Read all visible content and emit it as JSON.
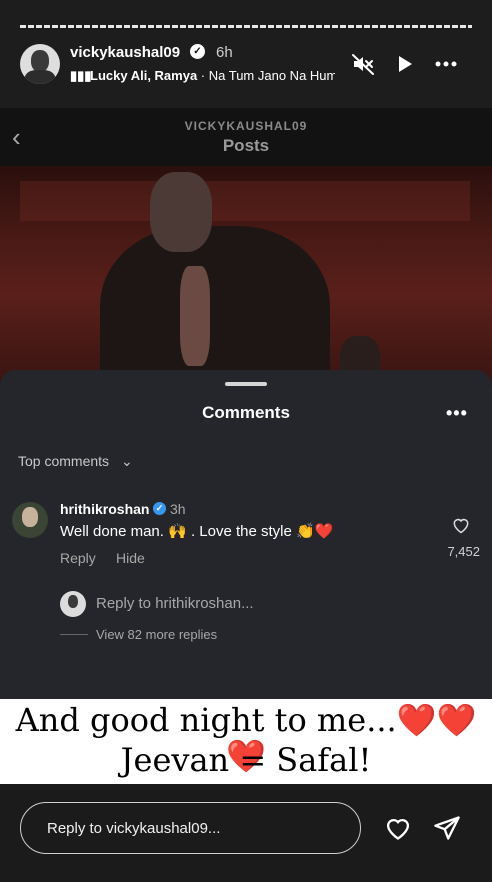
{
  "story": {
    "username": "vickykaushal09",
    "time": "6h",
    "music": {
      "artists": "Lucky Ali, Ramya",
      "separator": " · ",
      "song": "Na Tum Jano Na Hum"
    }
  },
  "post": {
    "username": "VICKYKAUSHAL09",
    "title": "Posts"
  },
  "comments": {
    "title": "Comments",
    "sort_label": "Top comments",
    "items": [
      {
        "username": "hrithikroshan",
        "time": "3h",
        "text": "Well done man. 🙌 . Love the style 👏",
        "heart": "❤️",
        "reply_label": "Reply",
        "hide_label": "Hide",
        "likes": "7,452"
      }
    ],
    "reply_placeholder": "Reply to hrithikroshan...",
    "view_more": "View 82 more replies"
  },
  "caption": {
    "line1": "And good night to me...",
    "hearts": "❤️❤️❤️",
    "line2": "Jeevan = Safal!"
  },
  "reply_box": {
    "placeholder": "Reply to vickykaushal09..."
  }
}
